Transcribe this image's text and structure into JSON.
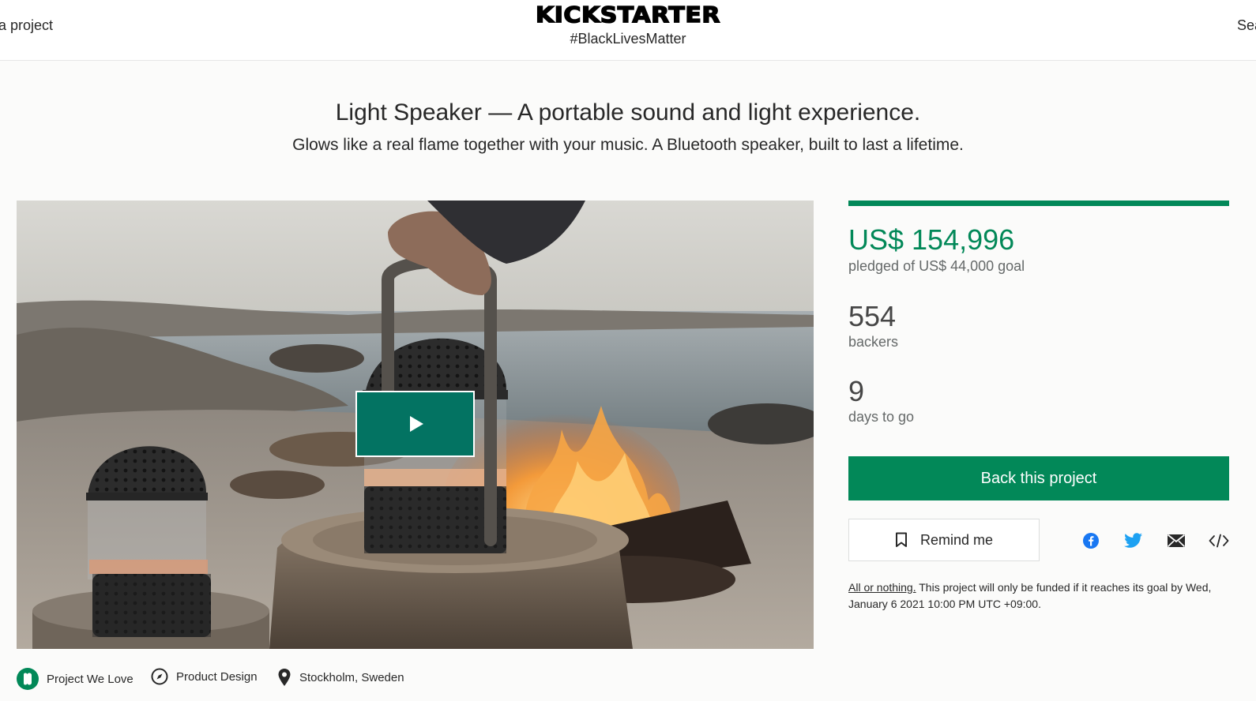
{
  "header": {
    "start_project": "a project",
    "logo": "KICKSTARTER",
    "tagline": "#BlackLivesMatter",
    "search": "Sea"
  },
  "project": {
    "title": "Light Speaker — A portable sound and light experience.",
    "subtitle": "Glows like a real flame together with your music. A Bluetooth speaker, built to last a lifetime."
  },
  "stats": {
    "pledged": "US$ 154,996",
    "pledged_of": "pledged of US$ 44,000 goal",
    "funded_fraction": 1.0,
    "backers": "554",
    "backers_label": "backers",
    "days": "9",
    "days_label": "days to go"
  },
  "actions": {
    "back": "Back this project",
    "remind": "Remind me"
  },
  "share_icons": [
    "facebook-icon",
    "twitter-icon",
    "email-icon",
    "embed-icon"
  ],
  "all_or_nothing": {
    "link": "All or nothing.",
    "text": " This project will only be funded if it reaches its goal by Wed, January 6 2021 10:00 PM UTC +09:00."
  },
  "meta": {
    "badge": "Project We Love",
    "category": "Product Design",
    "location": "Stockholm, Sweden"
  },
  "colors": {
    "brand_green": "#028858",
    "play_button": "#037362",
    "facebook": "#1877f2",
    "twitter": "#1da1f2"
  }
}
